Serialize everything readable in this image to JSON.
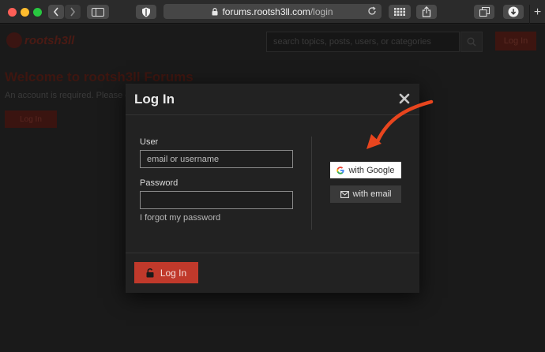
{
  "browser": {
    "url_host": "forums.rootsh3ll.com",
    "url_path": "/login",
    "new_tab_label": "+"
  },
  "site": {
    "logo_text": "rootsh3ll",
    "search_placeholder": "search topics, posts, users, or categories",
    "login_button": "Log In",
    "welcome_title": "Welcome to rootsh3ll Forums",
    "account_notice": "An account is required. Please cre",
    "page_login_button": "Log In"
  },
  "modal": {
    "title": "Log In",
    "user_label": "User",
    "user_placeholder": "email or username",
    "password_label": "Password",
    "forgot_link": "I forgot my password",
    "google_button": "with Google",
    "email_button": "with email",
    "submit_button": "Log In"
  },
  "colors": {
    "accent": "#c0392b",
    "annotation_arrow": "#e8451e"
  }
}
